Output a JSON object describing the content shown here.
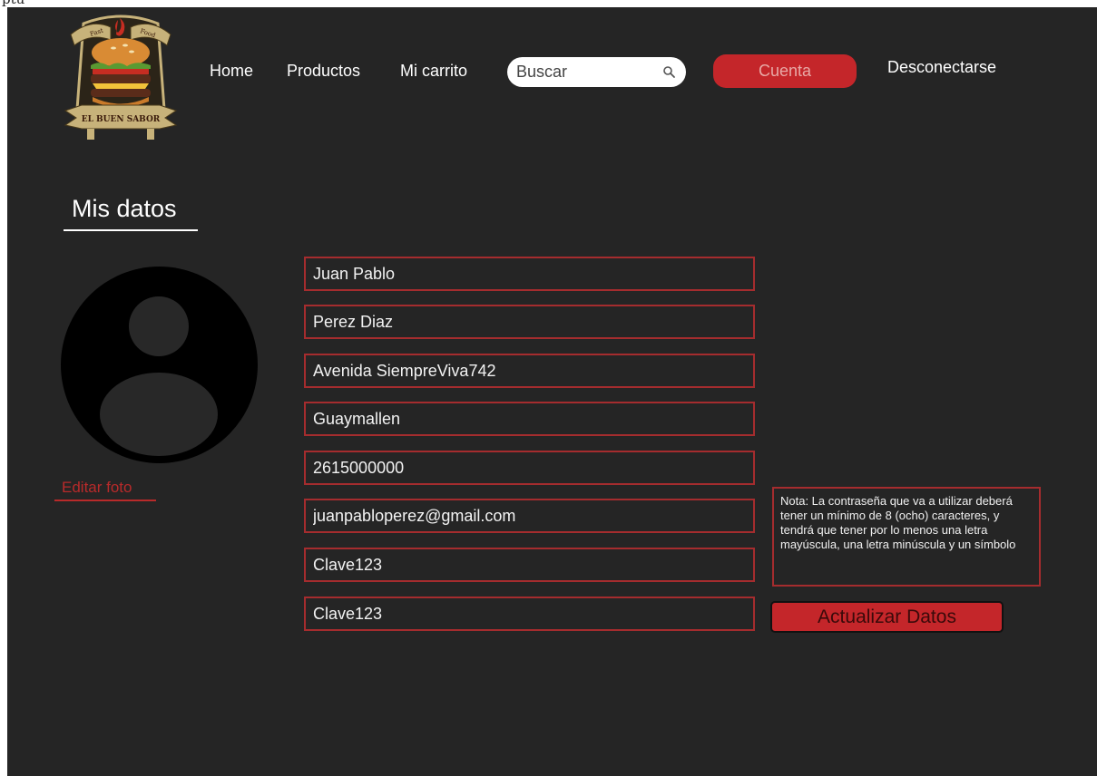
{
  "corner_text": "ptu",
  "logo": {
    "top_text_left": "Fast",
    "top_text_right": "Food",
    "ribbon_text": "EL BUEN SABOR",
    "colors": {
      "ribbon": "#c7b27a",
      "bun": "#d98b34",
      "lettuce": "#5a9a32",
      "patty": "#5a2c1a",
      "tomato": "#c62d22"
    }
  },
  "nav": {
    "home": "Home",
    "products": "Productos",
    "cart": "Mi carrito",
    "search_placeholder": "Buscar",
    "account": "Cuenta",
    "logout": "Desconectarse"
  },
  "page": {
    "title": "Mis datos",
    "edit_photo": "Editar foto"
  },
  "form": {
    "first_name": "Juan Pablo",
    "last_name": "Perez Diaz",
    "address": "Avenida SiempreViva742",
    "district": "Guaymallen",
    "phone": "2615000000",
    "email": "juanpabloperez@gmail.com",
    "password": "Clave123",
    "password_confirm": "Clave123"
  },
  "note": "Nota: La contraseña que va a utilizar deberá tener un mínimo de 8 (ocho) caracteres, y tendrá que tener por lo menos una letra mayúscula, una letra minúscula y un símbolo",
  "update_button": "Actualizar Datos",
  "colors": {
    "background": "#252525",
    "accent": "#c4262a",
    "field_border": "#a52c2e",
    "text": "#ffffff"
  },
  "icons": {
    "search": "magnifier-icon",
    "avatar": "user-silhouette-icon"
  }
}
